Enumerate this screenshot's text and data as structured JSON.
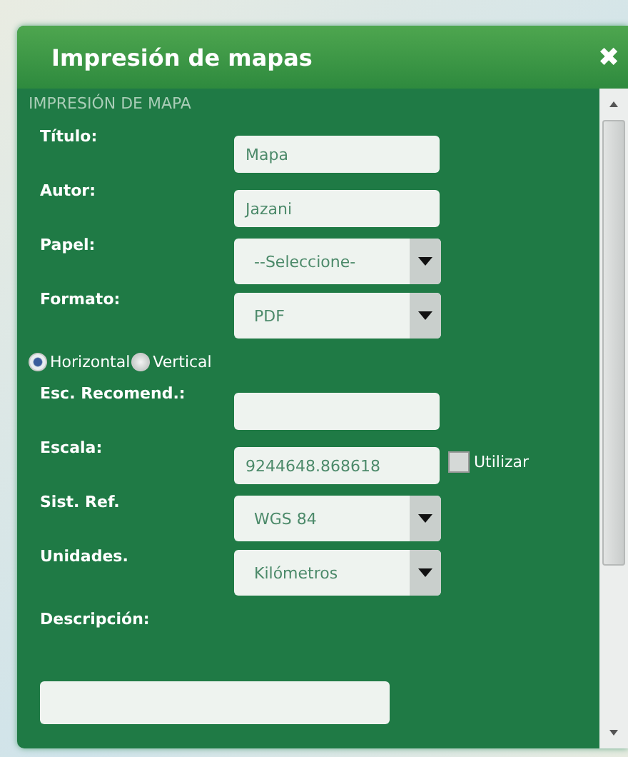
{
  "window": {
    "title": "Impresión de mapas",
    "close": "✖"
  },
  "section": "IMPRESIÓN DE MAPA",
  "fields": [
    {
      "kind": "text",
      "label": "Título:",
      "value": "Mapa"
    },
    {
      "kind": "text",
      "label": "Autor:",
      "value": "Jazani"
    },
    {
      "kind": "select",
      "label": "Papel:",
      "value": "--Seleccione-"
    },
    {
      "kind": "select",
      "label": "Formato:",
      "value": "PDF"
    },
    {
      "kind": "radios",
      "options": [
        {
          "label": "Horizontal",
          "selected": true
        },
        {
          "label": "Vertical",
          "selected": false
        }
      ]
    },
    {
      "kind": "text",
      "label": "Esc. Recomend.:"
    },
    {
      "kind": "scale",
      "label": "Escala:",
      "value": "9244648.868618",
      "check": {
        "label": "Utilizar",
        "checked": false
      }
    },
    {
      "kind": "select",
      "label": "Sist. Ref.",
      "value": "WGS 84"
    },
    {
      "kind": "select",
      "label": "Unidades.",
      "value": "Kilómetros"
    },
    {
      "kind": "textarea",
      "label": "Descripción:"
    }
  ]
}
